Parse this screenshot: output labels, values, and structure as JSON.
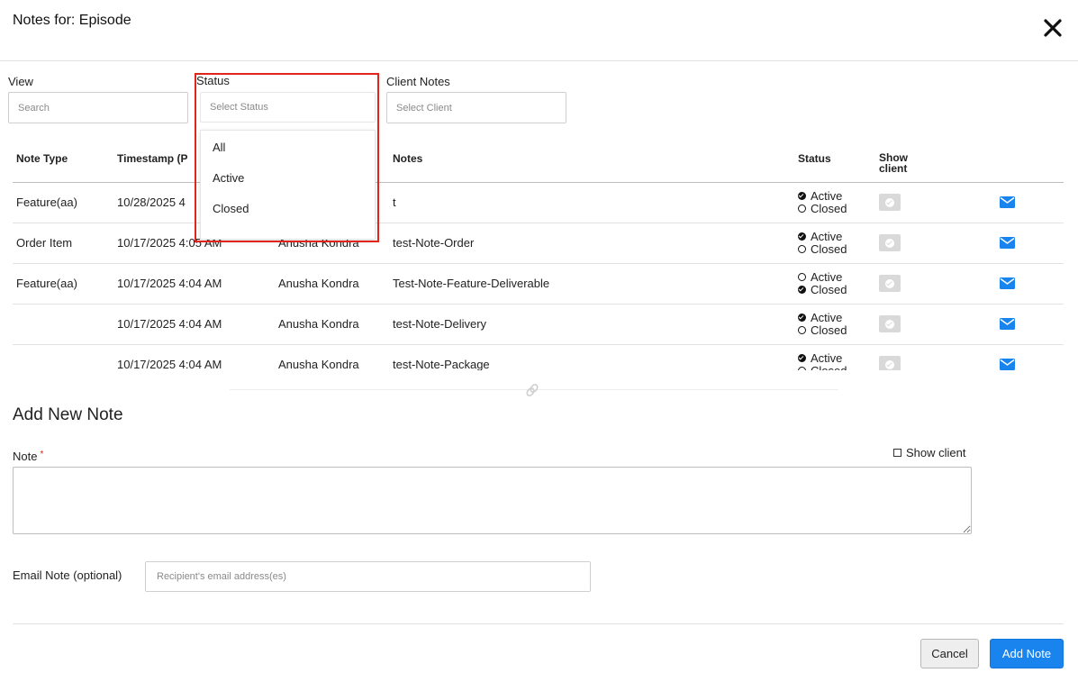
{
  "modal": {
    "title": "Notes for: Episode",
    "close_icon": "close-icon"
  },
  "filters": {
    "view": {
      "label": "View",
      "placeholder": "Search"
    },
    "status": {
      "label": "Status",
      "placeholder": "Select Status",
      "options": [
        "All",
        "Active",
        "Closed"
      ]
    },
    "client": {
      "label": "Client Notes",
      "placeholder": "Select Client"
    }
  },
  "table": {
    "headers": {
      "note_type": "Note Type",
      "timestamp": "Timestamp (P",
      "notes": "Notes",
      "status": "Status",
      "show_client_1": "Show",
      "show_client_2": "client"
    },
    "status_labels": {
      "active": "Active",
      "closed": "Closed"
    },
    "rows": [
      {
        "note_type": "Feature(aa)",
        "timestamp": "10/28/2025 4",
        "author": "",
        "note": "t",
        "status": "Active"
      },
      {
        "note_type": "Order Item",
        "timestamp": "10/17/2025 4:05 AM",
        "author": "Anusha Kondra",
        "note": "test-Note-Order",
        "status": "Active"
      },
      {
        "note_type": "Feature(aa)",
        "timestamp": "10/17/2025 4:04 AM",
        "author": "Anusha Kondra",
        "note": "Test-Note-Feature-Deliverable",
        "status": "Closed"
      },
      {
        "note_type": "",
        "timestamp": "10/17/2025 4:04 AM",
        "author": "Anusha Kondra",
        "note": "test-Note-Delivery",
        "status": "Active"
      },
      {
        "note_type": "",
        "timestamp": "10/17/2025 4:04 AM",
        "author": "Anusha Kondra",
        "note": "test-Note-Package",
        "status": "Active"
      }
    ]
  },
  "add_note": {
    "title": "Add New Note",
    "note_label": "Note",
    "required_mark": "*",
    "show_client_label": "Show client",
    "email_label": "Email Note (optional)",
    "email_placeholder": "Recipient's email address(es)"
  },
  "footer": {
    "cancel_label": "Cancel",
    "add_label": "Add Note"
  },
  "colors": {
    "highlight": "#e0251b",
    "primary": "#1a84ee",
    "mail": "#1a84ee"
  }
}
